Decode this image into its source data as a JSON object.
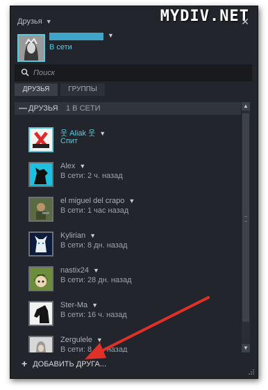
{
  "window": {
    "title": "Друзья",
    "watermark": "MYDIV.NET"
  },
  "profile": {
    "status": "В сети"
  },
  "search": {
    "placeholder": "Поиск"
  },
  "tabs": [
    {
      "label": "ДРУЗЬЯ"
    },
    {
      "label": "ГРУППЫ"
    }
  ],
  "list": {
    "header_label": "ДРУЗЬЯ",
    "header_count": "1 В СЕТИ",
    "friends": [
      {
        "name": "웃 Aliak 웃",
        "status": "Спит",
        "online": true,
        "avatar": "reyoftime-gaming-logo"
      },
      {
        "name": "Alex",
        "status": "В сети: 2 ч. назад",
        "online": false,
        "avatar": "wolf-silhouette"
      },
      {
        "name": "el miguel del crapo",
        "status": "В сети: 1 час назад",
        "online": false,
        "avatar": "game-character"
      },
      {
        "name": "Kylirian",
        "status": "В сети: 8 дн. назад",
        "online": false,
        "avatar": "white-wolf"
      },
      {
        "name": "nastix24",
        "status": "В сети: 28 дн. назад",
        "online": false,
        "avatar": "anime-character"
      },
      {
        "name": "Ster-Ma",
        "status": "В сети: 16 ч. назад",
        "online": false,
        "avatar": "horse-portrait"
      },
      {
        "name": "Zergulele",
        "status": "В сети: 8 дн. назад",
        "online": false,
        "avatar": "hooded-figure"
      }
    ]
  },
  "footer": {
    "add_friend": "ДОБАВИТЬ ДРУГА..."
  },
  "colors": {
    "online": "#57cbde",
    "arrow": "#e0302a",
    "background": "#22262c"
  }
}
